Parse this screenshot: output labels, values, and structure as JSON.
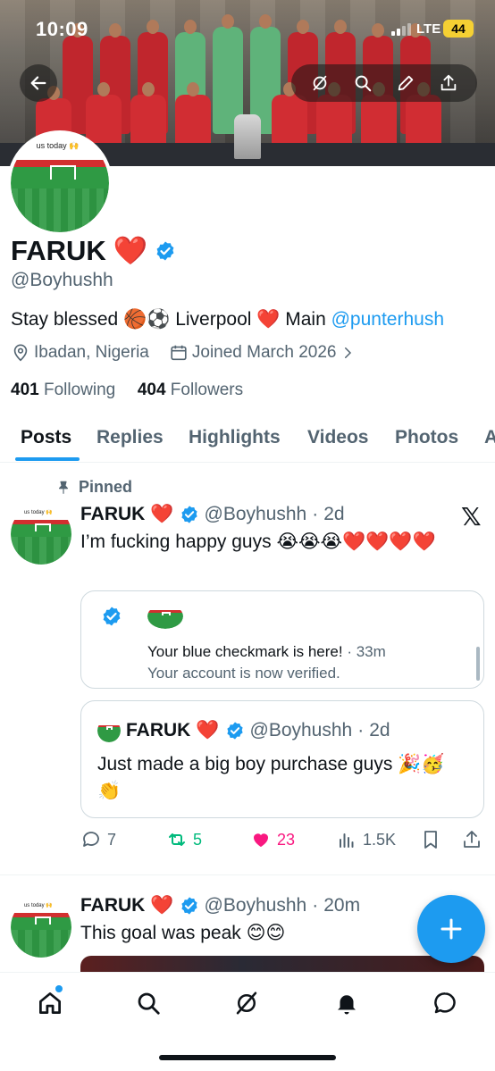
{
  "status": {
    "time": "10:09",
    "network": "LTE",
    "battery": "44"
  },
  "profile": {
    "name": "FARUK",
    "name_emoji": "❤️",
    "handle": "@Boyhushh",
    "avatar_caption": "us today 🙌",
    "bio_text": "Stay blessed 🏀⚽ Liverpool ❤️ Main ",
    "bio_link": "@punterhush",
    "location": "Ibadan, Nigeria",
    "joined": "Joined March 2026",
    "following_count": "401",
    "following_label": "Following",
    "followers_count": "404",
    "followers_label": "Followers"
  },
  "tabs": [
    {
      "label": "Posts",
      "active": true
    },
    {
      "label": "Replies"
    },
    {
      "label": "Highlights"
    },
    {
      "label": "Videos"
    },
    {
      "label": "Photos"
    },
    {
      "label": "A"
    }
  ],
  "pinned_post": {
    "pinned_label": "Pinned",
    "author": "FARUK",
    "author_emoji": "❤️",
    "handle": "@Boyhushh",
    "time": "2d",
    "text": "I’m fucking happy guys 😭😭😭❤️❤️❤️❤️",
    "notification_card": {
      "title": "Your blue checkmark is here!",
      "time": "33m",
      "subtitle": "Your account is now verified."
    },
    "quote": {
      "author": "FARUK",
      "author_emoji": "❤️",
      "handle": "@Boyhushh",
      "time": "2d",
      "text": "Just made a big boy purchase guys 🎉🥳👏"
    },
    "replies": "7",
    "reposts": "5",
    "likes": "23",
    "views": "1.5K"
  },
  "second_post": {
    "author": "FARUK",
    "author_emoji": "❤️",
    "handle": "@Boyhushh",
    "time": "20m",
    "text": "This goal was peak 😊😊"
  },
  "colors": {
    "accent": "#1d9bf0",
    "retweet": "#00ba7c",
    "like": "#f91880",
    "muted": "#536471"
  }
}
